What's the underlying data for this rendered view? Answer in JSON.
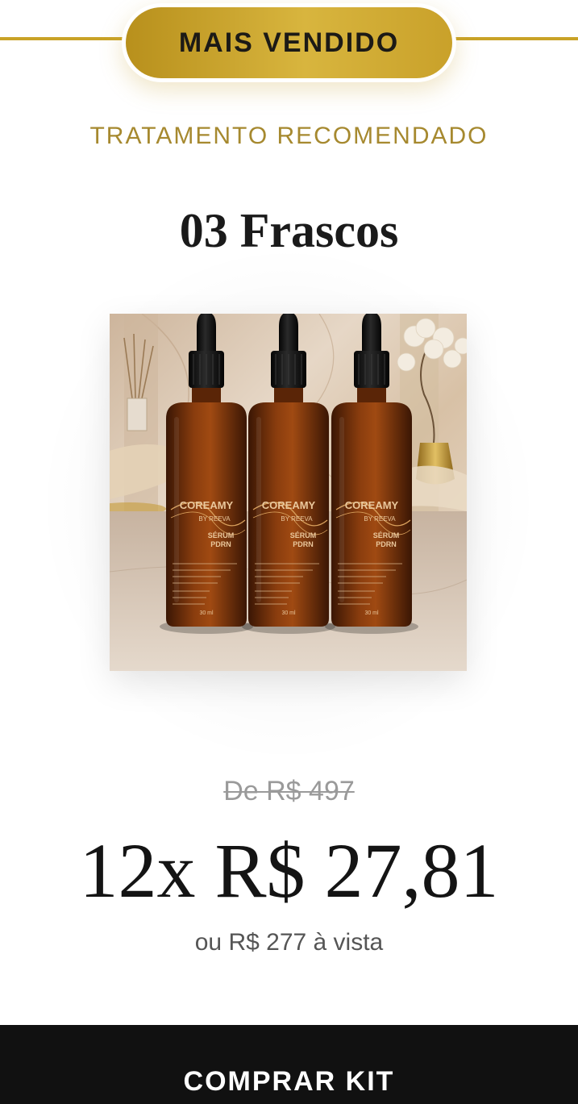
{
  "badge": {
    "label": "MAIS VENDIDO"
  },
  "offer": {
    "subtitle": "TRATAMENTO RECOMENDADO",
    "title": "03 Frascos"
  },
  "product": {
    "brand": "COREAMY",
    "sub_brand": "BY REEVA",
    "product_name": "SÉRUM PDRN",
    "volume": "30 ml",
    "bottle_count": 3,
    "bottle_text": [
      "Aumenta longevidade e energia celular",
      "Favorece o estímulo de colágeno",
      "Restaura a luminosidade",
      "Reduz rugas e linhas",
      "Phyto Exossoma",
      "PDRN 5000",
      "Antioxidante",
      "Cica"
    ]
  },
  "pricing": {
    "old_price": "De R$ 497",
    "installment": "12x R$ 27,81",
    "cash_price": "ou R$ 277 à vista"
  },
  "cta": {
    "label": "COMPRAR KIT"
  },
  "colors": {
    "gold": "#c9a227",
    "subtitle_gold": "#a6892f",
    "dark": "#111111"
  }
}
